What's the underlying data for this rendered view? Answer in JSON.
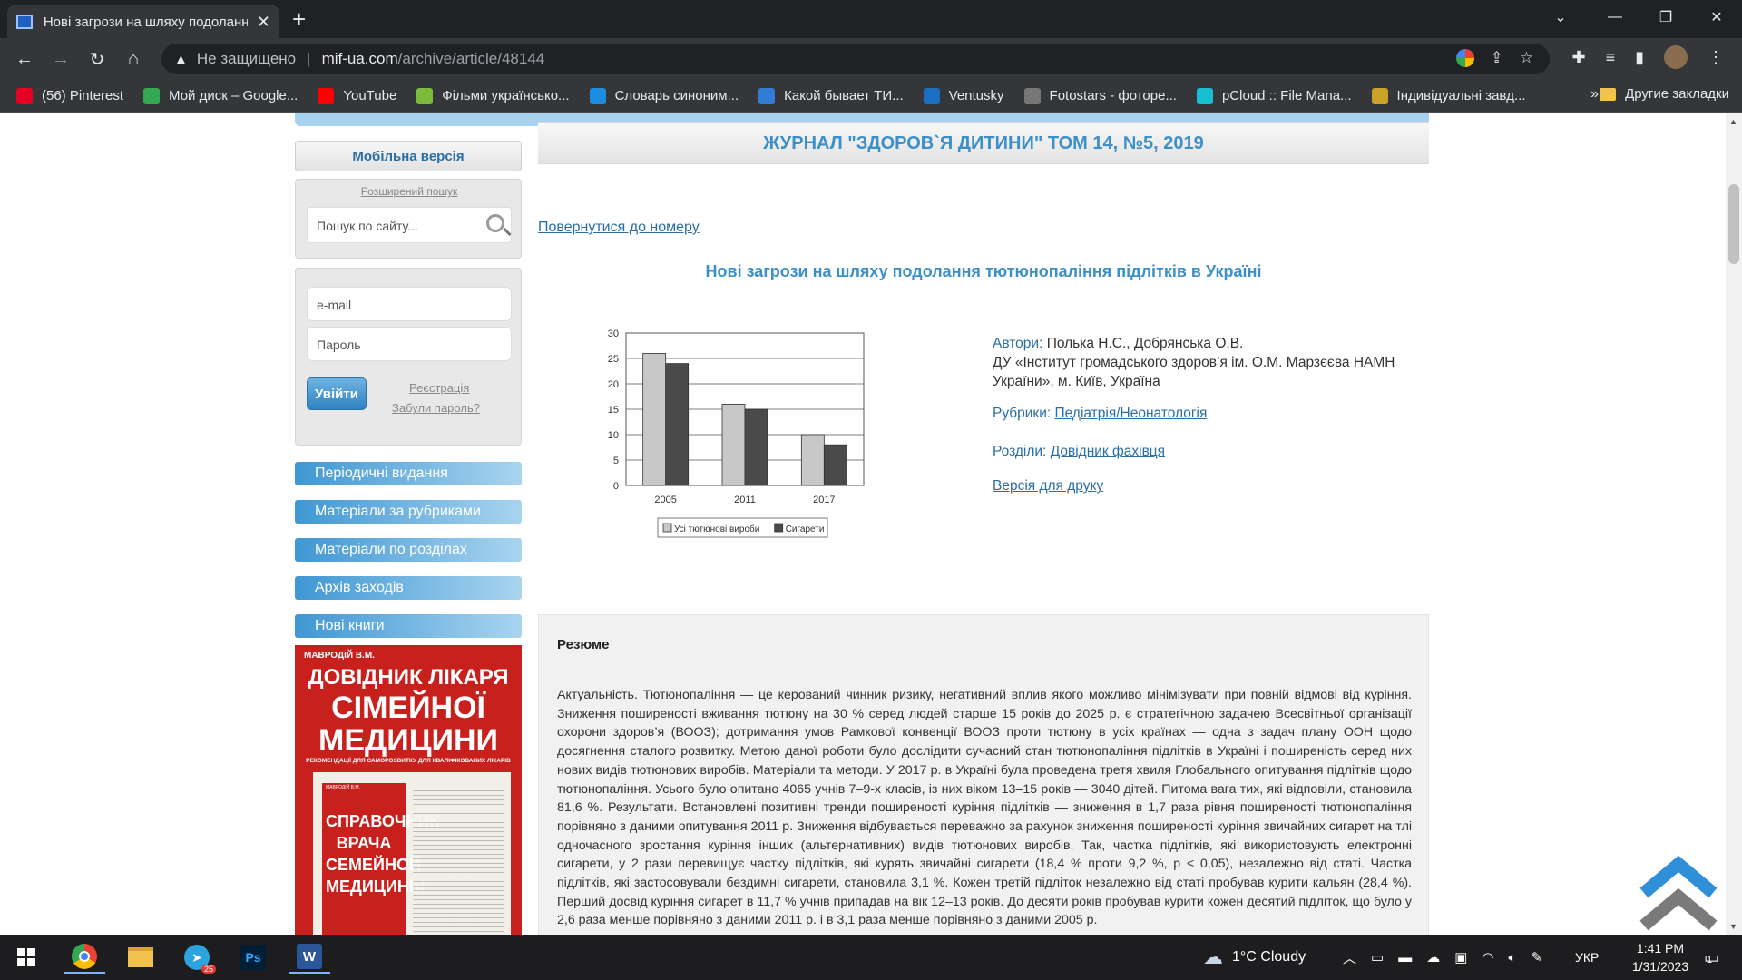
{
  "browser": {
    "tab_title": "Нові загрози на шляху подолання тютюнопаління підлітків в Україні",
    "tab_close": "✕",
    "new_tab": "+",
    "security_label": "Не защищено",
    "url_host": "mif-ua.com",
    "url_path": "/archive/article/48144",
    "window_min": "—",
    "window_max": "❐",
    "window_close": "✕"
  },
  "bookmarks": [
    {
      "label": "(56) Pinterest",
      "color": "#e60023"
    },
    {
      "label": "Мой диск – Google...",
      "color": "#34a853"
    },
    {
      "label": "YouTube",
      "color": "#ff0000"
    },
    {
      "label": "Фільми українсько...",
      "color": "#7dbb3c"
    },
    {
      "label": "Словарь синоним...",
      "color": "#1c8be0"
    },
    {
      "label": "Какой бывает ТИ...",
      "color": "#2f7dd4"
    },
    {
      "label": "Ventusky",
      "color": "#1a6fc4"
    },
    {
      "label": "Fotostars - фоторе...",
      "color": "#777777"
    },
    {
      "label": "pCloud :: File Mana...",
      "color": "#17bed0"
    },
    {
      "label": "Індивідуальні завд...",
      "color": "#c9a227"
    }
  ],
  "bookmarks_more": "»",
  "bookmarks_other": "Другие закладки",
  "sidebar": {
    "mobile_link": "Мобільна версія",
    "advanced_search": "Розширений пошук",
    "search_placeholder": "Пошук по сайту...",
    "email_placeholder": "e-mail",
    "password_placeholder": "Пароль",
    "login_button": "Увійти",
    "register_link": "Реєстрація",
    "forgot_link": "Забули пароль?",
    "menu": [
      "Періодичні видання",
      "Матеріали за рубриками",
      "Матеріали по розділах",
      "Архів заходів",
      "Нові книги"
    ],
    "book": {
      "author": "МАВРОДІЙ В.М.",
      "title_line1": "ДОВІДНИК ЛІКАРЯ",
      "title_line2": "СІМЕЙНОЇ",
      "title_line3": "МЕДИЦИНИ",
      "subtitle": "РЕКОМЕНДАЦІЇ ДЛЯ САМОРОЗВИТКУ ДЛЯ КВАЛІФІКОВАНИХ ЛІКАРІВ",
      "inner_author": "МАВРОДІЙ В.М.",
      "inner_title": "СПРАВОЧНИК ВРАЧА СЕМЕЙНОЙ МЕДИЦИНЫ"
    }
  },
  "main": {
    "journal_header": "ЖУРНАЛ \"ЗДОРОВ`Я ДИТИНИ\" ТОМ 14, №5, 2019",
    "back_link": "Повернутися до номеру",
    "article_title": "Нові загрози на шляху подолання тютюнопаління підлітків в Україні",
    "authors_label": "Автори:",
    "authors": "Полька Н.С., Добрянська О.В.",
    "affiliation": "ДУ «Інститут громадського здоров’я ім. О.М. Марзєєва НАМН України», м. Київ, Україна",
    "rubrics_label": "Рубрики:",
    "rubric": "Педіатрія/Неонатологія",
    "sections_label": "Розділи:",
    "section": "Довідник фахівця",
    "print_link": "Версія для друку",
    "resume_heading": "Резюме",
    "resume_text": "Актуальність. Тютюнопаління — це керований чинник ризику, негативний вплив якого можливо мінімізувати при повній відмові від куріння. Зниження поширеності вживання тютюну на 30 % серед людей старше 15 років до 2025 р. є стратегічною задачею Всесвітньої організації охорони здоров’я (ВООЗ); дотримання умов Рамкової конвенції ВООЗ проти тютюну в усіх країнах — одна з задач плану ООН щодо досягнення сталого розвитку. Метою даної роботи було дослідити сучасний стан тютюнопаління підлітків в Україні і поширеність серед них нових видів тютюнових виробів. Матеріали та методи. У 2017 р. в Україні була проведена третя хвиля Глобального опитування підлітків щодо тютюнопаління. Усього було опитано 4065 учнів 7–9-х класів, із них віком 13–15 років — 3040 дітей. Питома вага тих, які відповіли, становила 81,6 %. Результати. Встановлені позитивні тренди поширеності куріння підлітків — зниження в 1,7 раза рівня поширеності тютюнопаління порівняно з даними опитування 2011 р. Зниження відбувається переважно за рахунок зниження поширеності куріння звичайних сигарет на тлі одночасного зростання куріння інших (альтернативних) видів тютюнових виробів. Так, частка підлітків, які використовують електронні сигарети, у 2 рази перевищує частку підлітків, які курять звичайні сигарети (18,4 % проти 9,2 %, р < 0,05), незалежно від статі. Частка підлітків, які застосовували бездимні сигарети, становила 3,1 %. Кожен третій підліток незалежно від статі пробував курити кальян (28,4 %). Перший досвід куріння сигарет в 11,7 % учнів припадав на вік 12–13 років. До десяти років пробував курити кожен десятий підліток, що було у 2,6 раза менше порівняно з даними 2011 р. і в 3,1 раза менше порівняно з даними 2005 р."
  },
  "chart_data": {
    "type": "bar",
    "categories": [
      "2005",
      "2011",
      "2017"
    ],
    "series": [
      {
        "name": "Усі тютюнові вироби",
        "values": [
          26,
          16,
          10
        ],
        "color": "#c8c8c8"
      },
      {
        "name": "Сигарети",
        "values": [
          24,
          15,
          8
        ],
        "color": "#4a4a4a"
      }
    ],
    "ylim": [
      0,
      30
    ],
    "yticks": [
      0,
      5,
      10,
      15,
      20,
      25,
      30
    ],
    "grid": true,
    "legend": "bottom"
  },
  "taskbar": {
    "weather": "1°C  Cloudy",
    "language": "УКР",
    "time": "1:41 PM",
    "date": "1/31/2023",
    "telegram_badge": "25",
    "notifications": "1"
  }
}
